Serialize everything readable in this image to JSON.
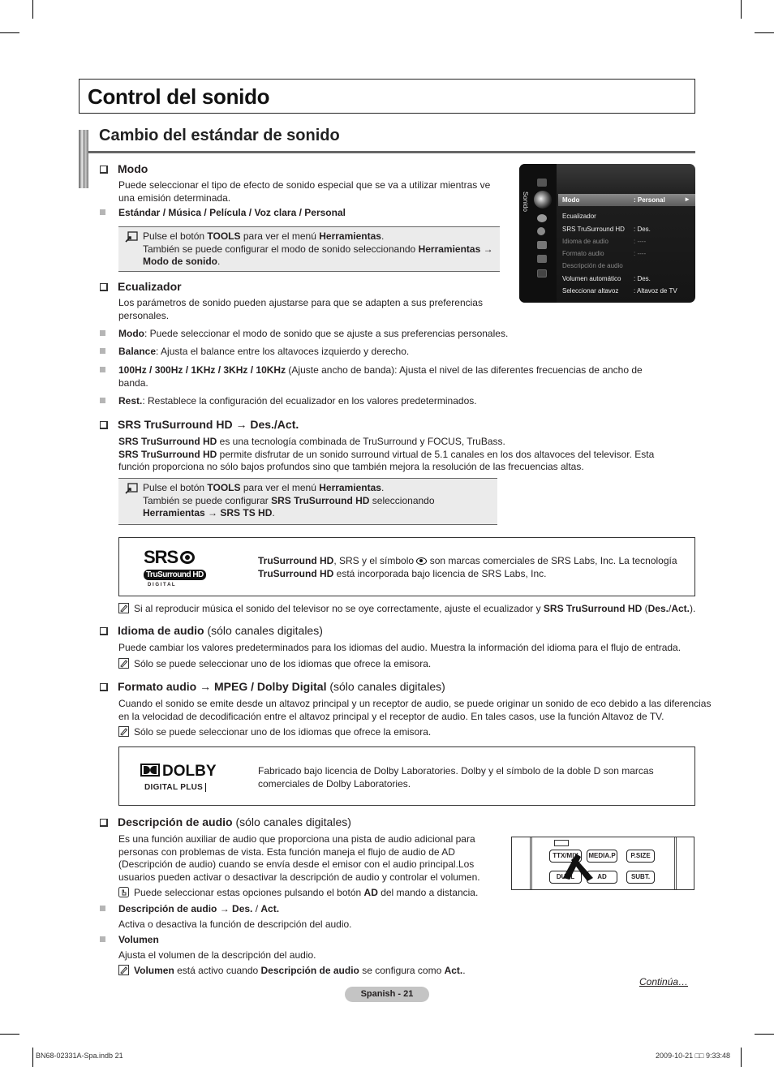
{
  "chapter_title": "Control del sonido",
  "section_title": "Cambio del estándar de sonido",
  "modo": {
    "heading": "Modo",
    "desc_1": "Puede seleccionar el tipo de efecto de sonido especial que se va a utilizar mientras ve",
    "desc_2": "una emisión determinada.",
    "options": [
      "Estándar",
      "Música",
      "Película",
      "Voz clara",
      "Personal"
    ],
    "tools_note": {
      "l1_a": "Pulse el botón ",
      "l1_b": "TOOLS",
      "l1_c": " para ver el menú ",
      "l1_d": "Herramientas",
      "l1_e": ".",
      "l2_a": "También se puede configurar el modo de sonido seleccionando ",
      "l2_b": "Herramientas →",
      "l3_a": "Modo de sonido",
      "l3_b": "."
    }
  },
  "osd_menu": {
    "category_label": "Sonido",
    "rows": [
      {
        "label": "Modo",
        "value": ": Personal",
        "state": "selected"
      },
      {
        "label": "Ecualizador",
        "value": "",
        "state": "normal"
      },
      {
        "label": "SRS TruSurround HD",
        "value": ": Des.",
        "state": "normal"
      },
      {
        "label": "Idioma de audio",
        "value": ": ----",
        "state": "disabled"
      },
      {
        "label": "Formato audio",
        "value": ": ----",
        "state": "disabled"
      },
      {
        "label": "Descripción de audio",
        "value": "",
        "state": "disabled"
      },
      {
        "label": "Volumen automático",
        "value": ": Des.",
        "state": "normal"
      },
      {
        "label": "Seleccionar altavoz",
        "value": ": Altavoz de TV",
        "state": "normal"
      }
    ],
    "arrow": "►"
  },
  "ecualizador": {
    "heading": "Ecualizador",
    "desc_1": "Los parámetros de sonido pueden ajustarse para que se adapten a sus preferencias",
    "desc_2": "personales.",
    "items": [
      {
        "bold": "Modo",
        "text": ": Puede seleccionar el modo de sonido que se ajuste a sus preferencias personales."
      },
      {
        "bold": "Balance",
        "text": ": Ajusta el balance entre los altavoces izquierdo y derecho."
      },
      {
        "bold": "100Hz / 300Hz / 1KHz / 3KHz / 10KHz",
        "text": " (Ajuste ancho de banda): Ajusta el nivel de las diferentes frecuencias de ancho de",
        "text2": "banda."
      },
      {
        "bold": "Rest.",
        "text": ": Restablece la configuración del ecualizador en los valores predeterminados."
      }
    ]
  },
  "srs": {
    "heading": "SRS TruSurround HD → Des./Act.",
    "p1_b": "SRS TruSurround HD",
    "p1_t": " es una tecnología combinada de TruSurround y FOCUS, TruBass.",
    "p2_b": "SRS TruSurround HD",
    "p2_t": " permite disfrutar de un sonido surround virtual de 5.1 canales en los dos altavoces del televisor. Esta",
    "p3": "función proporciona no sólo bajos profundos sino que también mejora la resolución de las frecuencias altas.",
    "tools_note": {
      "l1_a": "Pulse el botón ",
      "l1_b": "TOOLS",
      "l1_c": " para ver el menú ",
      "l1_d": "Herramientas",
      "l1_e": ".",
      "l2_a": "También se puede configurar ",
      "l2_b": "SRS TruSurround HD",
      "l2_c": " seleccionando",
      "l3_a": "Herramientas → SRS TS HD",
      "l3_b": "."
    },
    "logo": {
      "srs": "SRS",
      "badge": "TruSurround HD",
      "digital": "D I G I T A L"
    },
    "trademark_1_b": "TruSurround HD",
    "trademark_1_t": ", SRS y el símbolo",
    "trademark_1_t2": " son marcas comerciales de SRS Labs, Inc. La tecnología",
    "trademark_2_b": "TruSurround HD",
    "trademark_2_t": " está incorporada bajo licencia de SRS Labs, Inc.",
    "note_a": "Si al reproducir música el sonido del televisor no se oye correctamente, ajuste el ecualizador y ",
    "note_b": "SRS TruSurround HD",
    "note_c": " (",
    "note_d": "Des.",
    "note_e": "/",
    "note_f": "Act.",
    "note_g": ")."
  },
  "idioma": {
    "heading_b": "Idioma de audio",
    "heading_n": " (sólo canales digitales)",
    "desc": "Puede cambiar los valores predeterminados para los idiomas del audio. Muestra la información del idioma para el flujo de entrada.",
    "note": "Sólo se puede seleccionar uno de los idiomas que ofrece la emisora."
  },
  "formato": {
    "heading_b": "Formato audio → MPEG / Dolby Digital",
    "heading_n": " (sólo canales digitales)",
    "desc_1": "Cuando el sonido se emite desde un altavoz principal y un receptor de audio, se puede originar un sonido de eco debido a las diferencias",
    "desc_2": "en la velocidad de decodificación entre el altavoz principal y el receptor de audio. En tales casos, use la función Altavoz de TV.",
    "note": "Sólo se puede seleccionar uno de los idiomas que ofrece la emisora.",
    "dolby": {
      "name": "DOLBY",
      "sub": "DIGITAL PLUS",
      "text_1": "Fabricado bajo licencia de Dolby Laboratories. Dolby y el símbolo de la doble D son marcas",
      "text_2": "comerciales de Dolby Laboratories."
    }
  },
  "descripcion": {
    "heading_b": "Descripción de audio",
    "heading_n": " (sólo canales digitales)",
    "desc": [
      "Es una función auxiliar de audio que proporciona una pista de audio adicional para",
      "personas con problemas de vista. Esta función maneja el flujo de audio de AD",
      "(Descripción de audio) cuando se envía desde el emisor con el audio principal.Los",
      "usuarios pueden activar o desactivar la descripción de audio y controlar el volumen."
    ],
    "remote_note_a": "Puede seleccionar estas opciones pulsando el botón ",
    "remote_note_b": "AD",
    "remote_note_c": " del mando a distancia.",
    "remote_buttons": [
      "TTX/MIX",
      "MEDIA.P",
      "P.SIZE",
      "DUAL",
      "AD",
      "SUBT."
    ],
    "item1_b": "Descripción de audio → Des.",
    "item1_s": " / ",
    "item1_b2": "Act.",
    "item1_desc": "Activa o desactiva la función de descripción del audio.",
    "item2_b": "Volumen",
    "item2_desc": "Ajusta el volumen de la descripción del audio.",
    "note_a": "Volumen",
    "note_b": " está activo cuando ",
    "note_c": "Descripción de audio",
    "note_d": " se configura como ",
    "note_e": "Act.",
    "note_f": "."
  },
  "continua": "Continúa…",
  "page_label": "Spanish - 21",
  "slug_left": "BN68-02331A-Spa.indb   21",
  "slug_right": "2009-10-21   □□ 9:33:48"
}
